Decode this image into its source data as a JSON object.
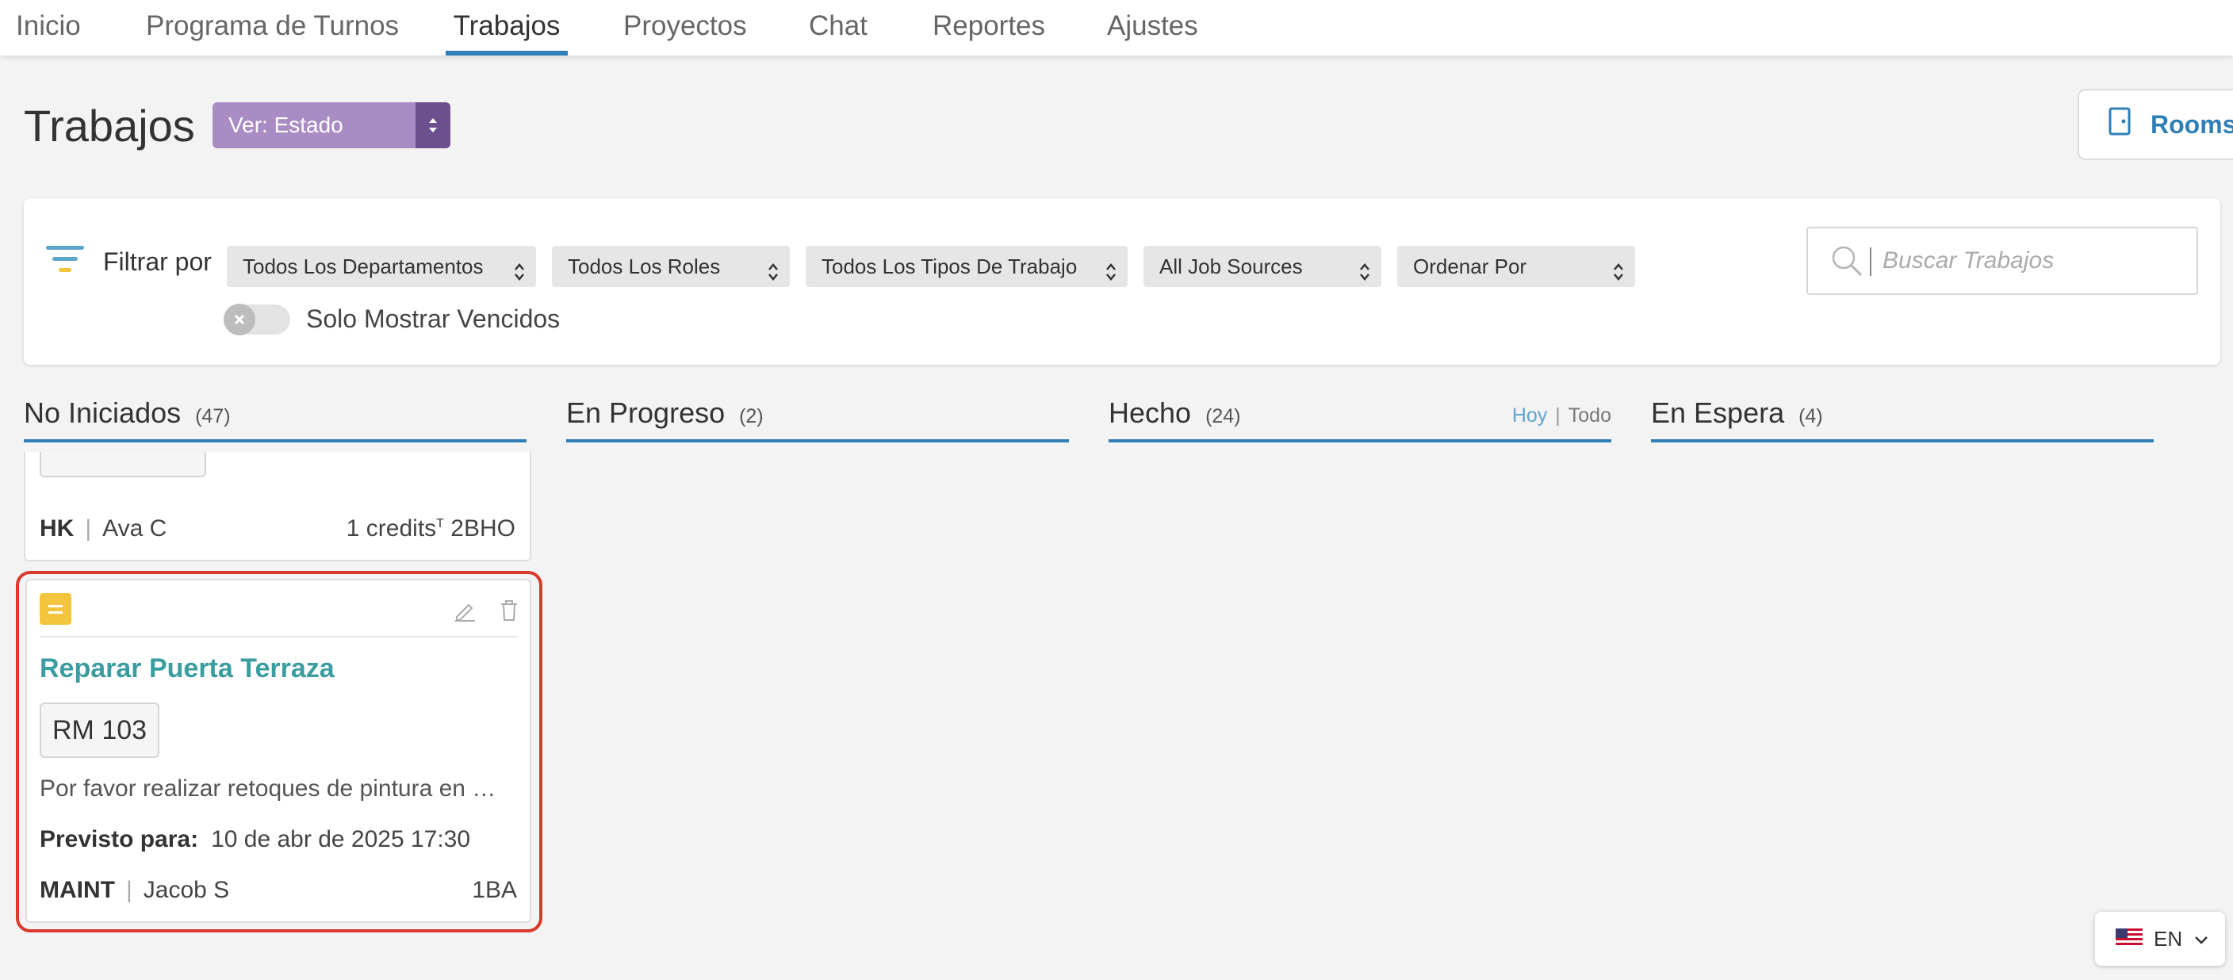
{
  "nav": {
    "tabs": [
      {
        "label": "Inicio"
      },
      {
        "label": "Programa de Turnos"
      },
      {
        "label": "Trabajos"
      },
      {
        "label": "Proyectos"
      },
      {
        "label": "Chat"
      },
      {
        "label": "Reportes"
      },
      {
        "label": "Ajustes"
      }
    ],
    "active": "Trabajos"
  },
  "header": {
    "title": "Trabajos",
    "view_select": "Ver: Estado",
    "rooms_button": "Rooms"
  },
  "filters": {
    "label": "Filtrar por",
    "dropdowns": [
      {
        "label": "Todos Los Departamentos"
      },
      {
        "label": "Todos Los Roles"
      },
      {
        "label": "Todos Los Tipos De Trabajo"
      },
      {
        "label": "All Job Sources"
      },
      {
        "label": "Ordenar Por"
      }
    ],
    "search_placeholder": "Buscar Trabajos",
    "overdue_toggle_label": "Solo Mostrar Vencidos",
    "overdue_toggle_on": false
  },
  "columns": [
    {
      "title": "No Iniciados",
      "count": "(47)"
    },
    {
      "title": "En Progreso",
      "count": "(2)"
    },
    {
      "title": "Hecho",
      "count": "(24)",
      "link_today": "Hoy",
      "link_all": "Todo"
    },
    {
      "title": "En Espera",
      "count": "(4)"
    }
  ],
  "partial_card": {
    "dept": "HK",
    "assignee": "Ava C",
    "credits": "1 credits",
    "credits_sup": "T",
    "unit_type": "2BHO"
  },
  "job_card": {
    "priority_color": "#f3c53d",
    "title": "Reparar Puerta Terraza",
    "room": "RM 103",
    "description": "Por favor realizar retoques de pintura en …",
    "due_label": "Previsto para:",
    "due_value": "10 de abr de 2025 17:30",
    "dept": "MAINT",
    "assignee": "Jacob S",
    "unit_type": "1BA"
  },
  "language": {
    "code": "EN",
    "flag_icon": "us-flag-icon"
  },
  "colors": {
    "accent_blue": "#2f7fb7",
    "view_select_bg": "#a98cc4",
    "job_title_teal": "#3a9da0",
    "highlight_red": "#d93a2b"
  }
}
